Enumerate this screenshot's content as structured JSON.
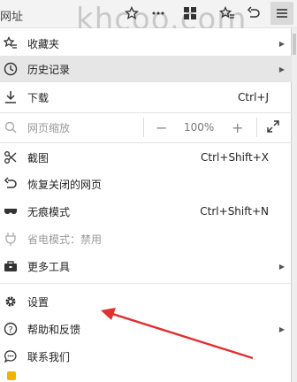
{
  "toolbar": {
    "address_fragment": "网址",
    "watermark": "khcoo.com",
    "icons": [
      "star-icon",
      "more-dots-icon",
      "grid-icon",
      "star-list-icon",
      "back-icon",
      "menu-icon"
    ]
  },
  "menu": {
    "items": {
      "favorites": {
        "label": "收藏夹",
        "icon": "star-list-icon",
        "has_submenu": true
      },
      "history": {
        "label": "历史记录",
        "icon": "clock-icon",
        "has_submenu": true
      },
      "downloads": {
        "label": "下载",
        "icon": "download-icon",
        "shortcut": "Ctrl+J"
      },
      "zoom": {
        "label": "网页缩放",
        "icon": "zoom-icon",
        "minus": "−",
        "value": "100%",
        "plus": "+"
      },
      "screenshot": {
        "label": "截图",
        "icon": "scissors-icon",
        "shortcut": "Ctrl+Shift+X"
      },
      "restore": {
        "label": "恢复关闭的网页",
        "icon": "restore-icon"
      },
      "incognito": {
        "label": "无痕模式",
        "icon": "mask-icon",
        "shortcut": "Ctrl+Shift+N"
      },
      "power_save": {
        "label": "省电模式：禁用",
        "icon": "plug-icon"
      },
      "more_tools": {
        "label": "更多工具",
        "icon": "toolbox-icon",
        "has_submenu": true
      },
      "settings": {
        "label": "设置",
        "icon": "gear-icon"
      },
      "help": {
        "label": "帮助和反馈",
        "icon": "help-icon",
        "has_submenu": true
      },
      "contact": {
        "label": "联系我们",
        "icon": "chat-icon"
      }
    }
  },
  "annotation": {
    "color": "#e03030"
  }
}
